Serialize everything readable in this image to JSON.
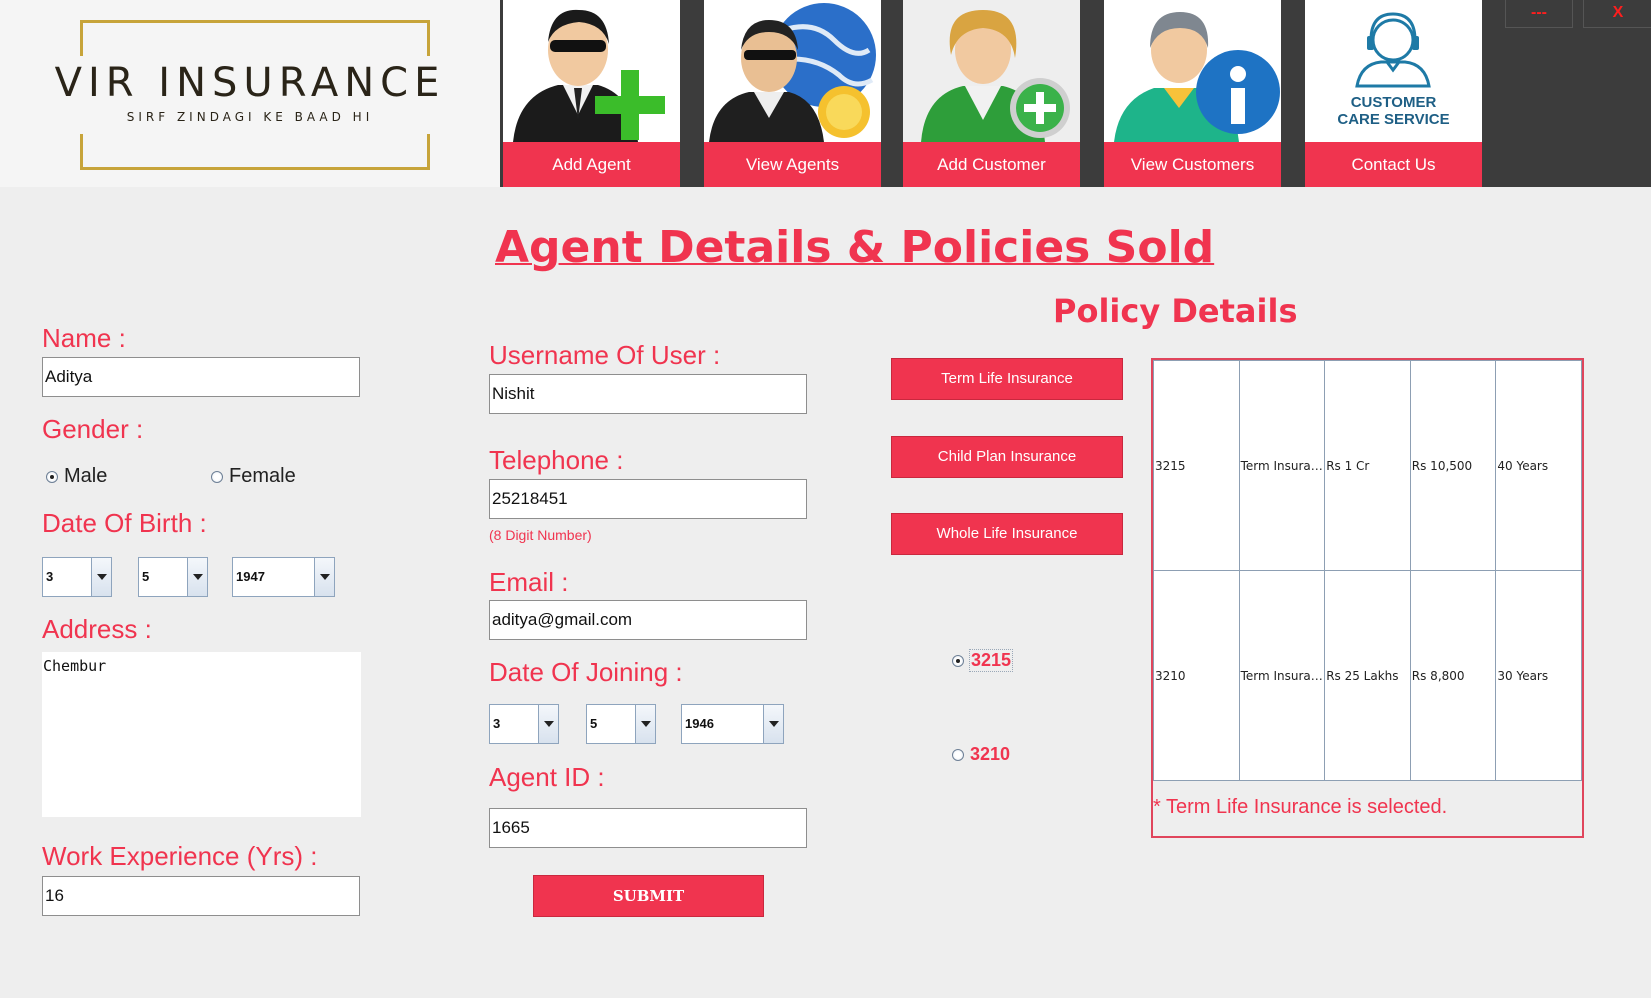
{
  "app": {
    "logo_title": "VIR INSURANCE",
    "logo_tagline": "SIRF ZINDAGI KE BAAD HI",
    "minimize_label": "---",
    "close_label": "X"
  },
  "nav": {
    "add_agent": {
      "label": "Add Agent",
      "icon": "agent-add-icon"
    },
    "view_agents": {
      "label": "View Agents",
      "icon": "agent-globe-icon"
    },
    "add_customer": {
      "label": "Add Customer",
      "icon": "customer-add-icon"
    },
    "view_customers": {
      "label": "View Customers",
      "icon": "customer-info-icon"
    },
    "contact_us": {
      "label": "Contact Us",
      "icon": "customer-care-icon",
      "badge_line1": "CUSTOMER",
      "badge_line2": "CARE SERVICE"
    }
  },
  "page": {
    "title": "Agent Details & Policies Sold",
    "policy_title": "Policy Details"
  },
  "form": {
    "name_label": "Name :",
    "name_value": "Aditya",
    "gender_label": "Gender :",
    "gender_male": "Male",
    "gender_female": "Female",
    "gender_selected": "Male",
    "dob_label": "Date Of Birth :",
    "dob_day": "3",
    "dob_month": "5",
    "dob_year": "1947",
    "address_label": "Address :",
    "address_value": "Chembur",
    "experience_label": "Work Experience (Yrs) :",
    "experience_value": "16",
    "username_label": "Username Of User :",
    "username_value": "Nishit",
    "telephone_label": "Telephone :",
    "telephone_value": "25218451",
    "telephone_hint": "(8 Digit Number)",
    "email_label": "Email :",
    "email_value": "aditya@gmail.com",
    "doj_label": "Date Of Joining :",
    "doj_day": "3",
    "doj_month": "5",
    "doj_year": "1946",
    "agent_id_label": "Agent ID :",
    "agent_id_value": "1665",
    "submit_label": "SUBMIT"
  },
  "policy_buttons": {
    "term": "Term Life Insurance",
    "child": "Child Plan Insurance",
    "whole": "Whole Life Insurance"
  },
  "policy_radios": {
    "first": "3215",
    "second": "3210",
    "selected": "3215"
  },
  "policy_table": {
    "rows": [
      [
        "3215",
        "Term Insurance",
        "Rs 1 Cr",
        "Rs 10,500",
        "40 Years"
      ],
      [
        "3210",
        "Term Insurance",
        "Rs 25 Lakhs",
        "Rs 8,800",
        "30 Years"
      ]
    ],
    "note": "* Term Life Insurance is selected."
  },
  "colors": {
    "accent": "#f0344f",
    "header_dark": "#3c3c3c",
    "logo_gold": "#c7a43a"
  }
}
